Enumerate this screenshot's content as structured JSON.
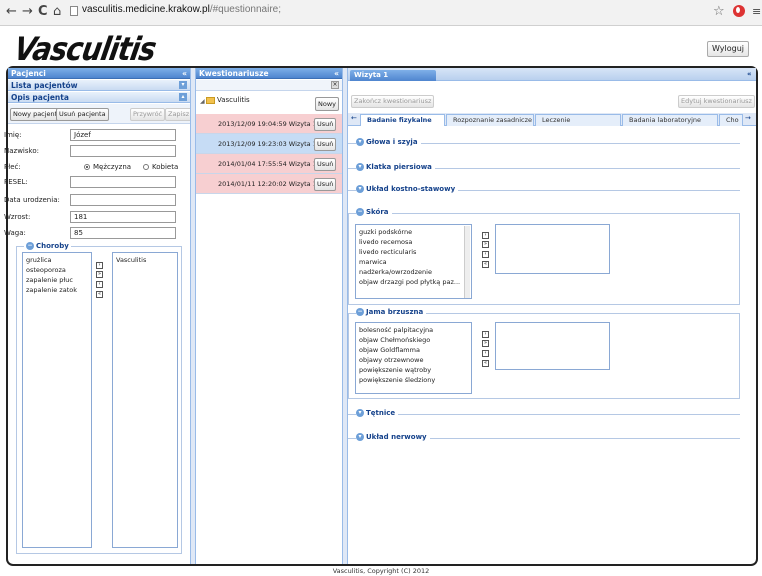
{
  "browser": {
    "back": "←",
    "forward": "→",
    "reload": "C",
    "home": "⌂",
    "url_host": "vasculitis.medicine.krakow.pl",
    "url_path": "/#questionnaire;",
    "star": "☆",
    "menu": "≡"
  },
  "app": {
    "logo": "Vasculitis",
    "logout": "Wyloguj",
    "footer": "Vasculitis, Copyright (C) 2012"
  },
  "left": {
    "patients_header": "Pacjenci",
    "patients_list_header": "Lista pacjentów",
    "patient_desc_header": "Opis pacjenta",
    "buttons": {
      "new": "Nowy pacjent",
      "delete": "Usuń pacjenta",
      "restore": "Przywróć",
      "save": "Zapisz"
    },
    "fields": [
      {
        "label": "Imię:",
        "value": "Józef"
      },
      {
        "label": "Nazwisko:",
        "value": ""
      },
      {
        "label": "Płeć:",
        "value": ""
      },
      {
        "label": "PESEL:",
        "value": ""
      },
      {
        "label": "Data urodzenia:",
        "value": ""
      },
      {
        "label": "Wzrost:",
        "value": "181"
      },
      {
        "label": "Waga:",
        "value": "85"
      }
    ],
    "sex_options": {
      "male": "Mężczyzna",
      "female": "Kobieta"
    },
    "diseases_legend": "Choroby",
    "diseases_available": [
      "grużlica",
      "osteoporoza",
      "zapalenie płuc",
      "zapalenie zatok"
    ],
    "diseases_selected": [
      "Vasculitis"
    ]
  },
  "middle": {
    "header": "Kwestionariusze",
    "tree_label": "Vasculitis",
    "new_button": "Nowy",
    "delete_label": "Usuń",
    "rows": [
      {
        "text": "2013/12/09 19:04:59 Wizyta 1",
        "status": "pink"
      },
      {
        "text": "2013/12/09 19:23:03 Wizyta 1",
        "status": "blue"
      },
      {
        "text": "2014/01/04 17:55:54 Wizyta 1",
        "status": "pink"
      },
      {
        "text": "2014/01/11 12:20:02 Wizyta 1",
        "status": "pink"
      }
    ]
  },
  "right": {
    "visit_tab": "Wizyta 1",
    "finish_button": "Zakończ kwestionariusz",
    "edit_button": "Edytuj kwestionariusz",
    "tabs": [
      "Badanie fizykalne",
      "Rozpoznanie zasadnicze",
      "Leczenie",
      "Badania laboratoryjne",
      "Cho"
    ],
    "sections": [
      "Głowa i szyja",
      "Klatka piersiowa",
      "Układ kostno-stawowy",
      "Skóra",
      "Jama brzuszna",
      "Tętnice",
      "Układ nerwowy"
    ],
    "skin_items": [
      "guzki podskórne",
      "livedo recemosa",
      "livedo recticularis",
      "marwica",
      "nadżerka/owrzodzenie",
      "objaw drzazgi pod płytką paz..."
    ],
    "abdomen_items": [
      "bolesność palpitacyjna",
      "objaw Chełmońskiego",
      "objaw Goldflamma",
      "objawy otrzewnowe",
      "powiększenie wątroby",
      "powiększenie śledziony"
    ]
  }
}
